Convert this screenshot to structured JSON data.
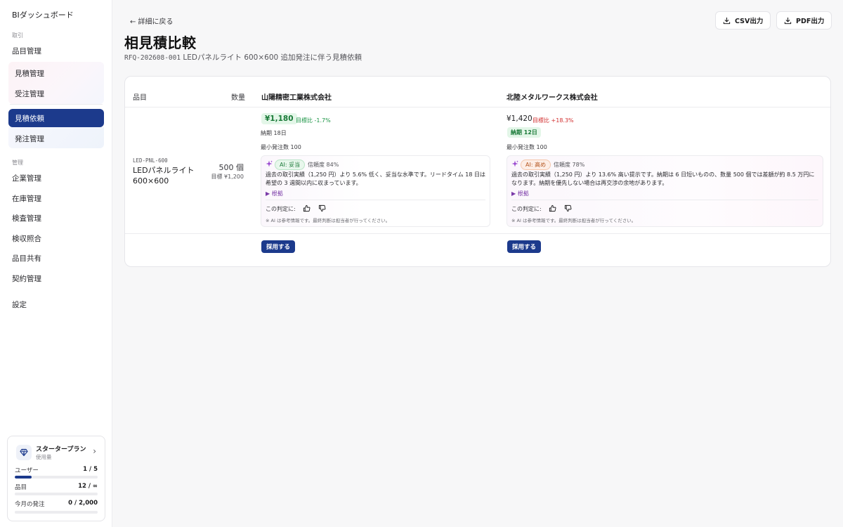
{
  "sidebar": {
    "app_title": "BIダッシュボード",
    "section_trade": "取引",
    "item_master": "品目管理",
    "sub_quote_mgmt": "見積管理",
    "sub_order_mgmt": "受注管理",
    "active_rfq": "見積依頼",
    "sub_purchase": "発注管理",
    "section_admin": "管理",
    "admin_items": [
      "企業管理",
      "在庫管理",
      "検査管理",
      "検収照合",
      "品目共有",
      "契約管理"
    ],
    "settings": "設定"
  },
  "plan": {
    "name": "スタータープラン",
    "usage_label": "使用量",
    "rows": [
      {
        "label": "ユーザー",
        "value": "1 / 5",
        "fraction": 0.2
      },
      {
        "label": "品目",
        "value": "12 / ∞",
        "fraction": 0
      },
      {
        "label": "今月の発注",
        "value": "0 / 2,000",
        "fraction": 0
      }
    ],
    "accent": "#1c3a8c"
  },
  "header": {
    "back_label": "← 詳細に戻る",
    "csv_label": "CSV出力",
    "pdf_label": "PDF出力",
    "title": "相見積比較",
    "rfq_code": "RFQ-202608-001",
    "rfq_subject": " LEDパネルライト 600×600 追加発注に伴う見積依頼"
  },
  "table": {
    "col_item": "品目",
    "col_qty": "数量",
    "supplier_a": "山陽精密工業株式会社",
    "supplier_b": "北陸メタルワークス株式会社",
    "item_code": "LED-PNL-600",
    "item_name_l1": "LEDパネルライト",
    "item_name_l2": "600×600",
    "qty": "500 個",
    "target": "目標 ¥1,200"
  },
  "quote_a": {
    "price": "¥1,180",
    "ratio": "目標比 -1.7%",
    "lead": "納期 18日",
    "moq": "最小発注数 100",
    "ai_verdict": "AI: 妥当",
    "confidence": "信頼度 84%",
    "ai_text": "過去の取引実績（1,250 円）より 5.6% 低く、妥当な水準です。リードタイム 18 日は希望の 3 週間以内に収まっています。",
    "basis": "▶ 根拠",
    "judge": "この判定に:",
    "note": "※ AI は参考情報です。最終判断は担当者が行ってください。",
    "adopt": "採用する"
  },
  "quote_b": {
    "price": "¥1,420",
    "ratio": "目標比 +18.3%",
    "lead": "納期 12日",
    "moq": "最小発注数 100",
    "ai_verdict": "AI: 高め",
    "confidence": "信頼度 78%",
    "ai_text": "過去の取引実績（1,250 円）より 13.6% 高い提示です。納期は 6 日短いものの、数量 500 個では差額が約 8.5 万円になります。納期を優先しない場合は再交渉の余地があります。",
    "basis": "▶ 根拠",
    "judge": "この判定に:",
    "note": "※ AI は参考情報です。最終判断は担当者が行ってください。",
    "adopt": "採用する"
  },
  "colors": {
    "brand": "#1c3a8c",
    "good": "#1a7a38",
    "bad": "#d22c2c",
    "ai_purple": "#7a3aa8"
  }
}
